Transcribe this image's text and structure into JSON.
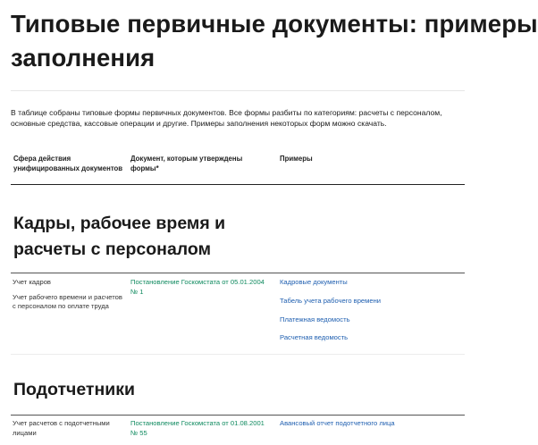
{
  "page": {
    "title": "Типовые первичные документы: примеры заполнения",
    "intro": "В таблице собраны типовые формы первичных документов. Все формы разбиты по категориям: расчеты с персоналом, основные средства, кассовые операции и другие. Примеры заполнения некоторых форм можно скачать."
  },
  "table_header": {
    "area": "Сфера действия унифицированных документов",
    "document": "Документ, которым утверждены формы*",
    "examples": "Примеры"
  },
  "sections": [
    {
      "title": "Кадры, рабочее время и расчеты с персоналом",
      "areas": [
        "Учет кадров",
        "Учет рабочего времени и расчетов с персоналом по оплате труда"
      ],
      "document": "Постановление Госкомстата от 05.01.2004 № 1",
      "examples": [
        "Кадровые документы",
        "Табель учета рабочего времени",
        "Платежная ведомость",
        "Расчетная ведомость"
      ]
    },
    {
      "title": "Подотчетники",
      "areas": [
        "Учет расчетов с подотчетными лицами"
      ],
      "document": "Постановление Госкомстата от 01.08.2001 № 55",
      "examples": [
        "Авансовый отчет подотчетного лица"
      ]
    }
  ]
}
